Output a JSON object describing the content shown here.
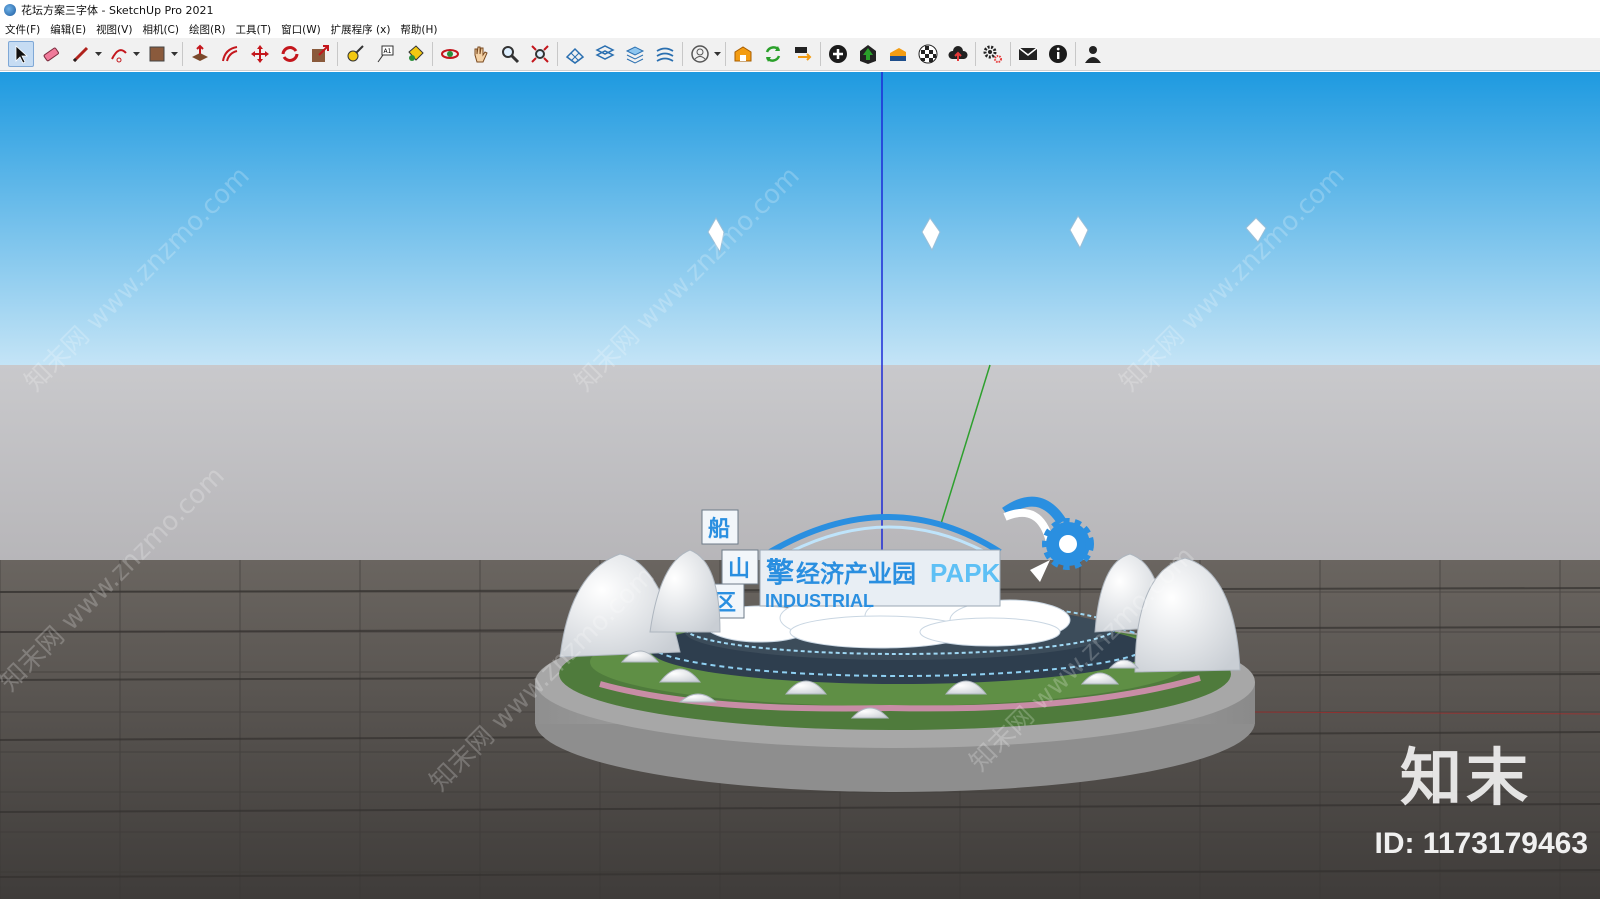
{
  "window": {
    "title": "花坛方案三字体 - SketchUp Pro 2021"
  },
  "menu": {
    "items": [
      "文件(F)",
      "编辑(E)",
      "视图(V)",
      "相机(C)",
      "绘图(R)",
      "工具(T)",
      "窗口(W)",
      "扩展程序 (x)",
      "帮助(H)"
    ]
  },
  "toolbar": {
    "tools": [
      {
        "icon": "select-arrow-icon",
        "active": true
      },
      {
        "icon": "eraser-icon"
      },
      {
        "icon": "pencil-line-icon",
        "dropdown": true
      },
      {
        "icon": "arc-icon",
        "dropdown": true
      },
      {
        "icon": "rectangle-shape-icon",
        "dropdown": true
      },
      {
        "icon": "push-pull-icon"
      },
      {
        "icon": "offset-icon"
      },
      {
        "icon": "move-icon"
      },
      {
        "icon": "rotate-icon"
      },
      {
        "icon": "scale-icon"
      },
      {
        "icon": "tape-measure-icon"
      },
      {
        "icon": "text-label-icon"
      },
      {
        "icon": "paint-bucket-icon"
      },
      {
        "icon": "orbit-icon"
      },
      {
        "icon": "pan-hand-icon"
      },
      {
        "icon": "zoom-icon"
      },
      {
        "icon": "zoom-extents-icon"
      },
      {
        "icon": "sandbox-icon"
      },
      {
        "icon": "layers-icon"
      },
      {
        "icon": "stack-icon"
      },
      {
        "icon": "terrain-icon"
      },
      {
        "icon": "account-icon",
        "dropdown": true
      },
      {
        "icon": "warehouse-icon"
      },
      {
        "icon": "sync-icon"
      },
      {
        "icon": "transfer-icon"
      },
      {
        "icon": "add-circle-icon"
      },
      {
        "icon": "tree-upload-icon"
      },
      {
        "icon": "trimble-connect-icon"
      },
      {
        "icon": "checker-icon"
      },
      {
        "icon": "cloud-upload-icon"
      },
      {
        "icon": "settings-gears-icon"
      },
      {
        "icon": "mail-icon"
      },
      {
        "icon": "info-icon"
      },
      {
        "icon": "user-icon"
      }
    ]
  },
  "scene": {
    "sign_vertical_chars": [
      "船",
      "山",
      "区"
    ],
    "sign_main_prefix": "擎",
    "sign_main_text": "经济产业园",
    "sign_latin": "PAPK",
    "sign_sub": "INDUSTRIAL",
    "sky_top": "#1e9ae0",
    "sky_bottom": "#bfe2f7",
    "floor_color": "#4a4644",
    "axis_blue": "#1d2bd6",
    "axis_green": "#2ea02e",
    "accent_blue": "#2a8fe0"
  },
  "watermark": {
    "brand": "知末",
    "id": "ID: 1173179463",
    "diagonal": "知末网 www.znzmo.com"
  }
}
